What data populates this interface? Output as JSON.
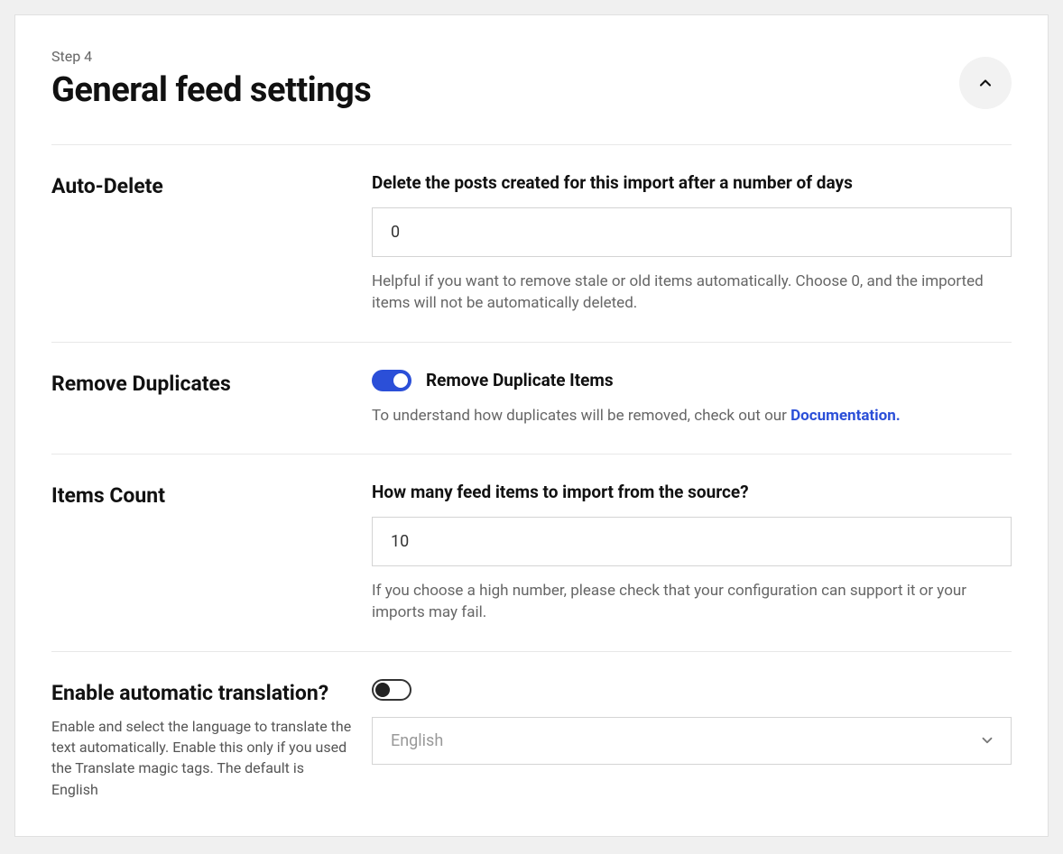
{
  "header": {
    "step_label": "Step 4",
    "title": "General feed settings"
  },
  "auto_delete": {
    "label": "Auto-Delete",
    "field_label": "Delete the posts created for this import after a number of days",
    "value": "0",
    "help": "Helpful if you want to remove stale or old items automatically. Choose 0, and the imported items will not be automatically deleted."
  },
  "remove_duplicates": {
    "label": "Remove Duplicates",
    "toggle_label": "Remove Duplicate Items",
    "toggle_on": true,
    "help_prefix": "To understand how duplicates will be removed, check out our ",
    "doc_link": "Documentation."
  },
  "items_count": {
    "label": "Items Count",
    "field_label": "How many feed items to import from the source?",
    "value": "10",
    "help": "If you choose a high number, please check that your configuration can support it or your imports may fail."
  },
  "translation": {
    "label": "Enable automatic translation?",
    "sublabel": "Enable and select the language to translate the text automatically. Enable this only if you used the Translate magic tags. The default is English",
    "toggle_on": false,
    "selected": "English"
  }
}
